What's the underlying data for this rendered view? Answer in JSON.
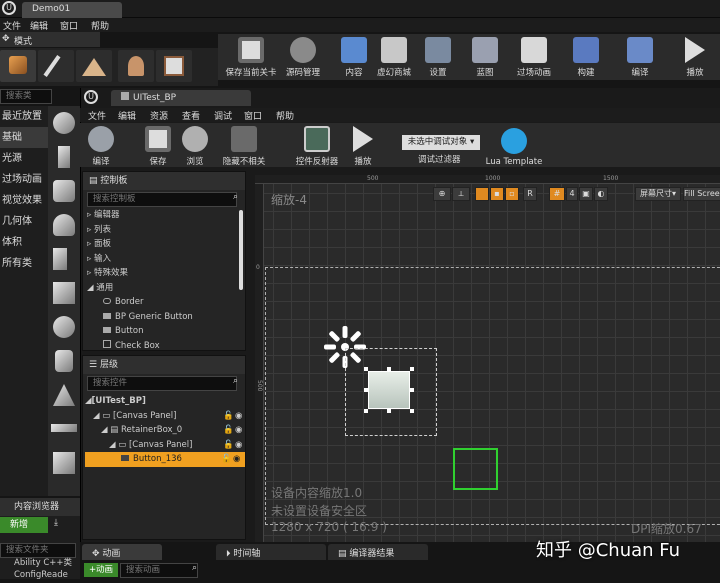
{
  "app": {
    "project_tab": "Demo01",
    "menu": [
      "文件",
      "编辑",
      "窗口",
      "帮助"
    ]
  },
  "modes": {
    "title": "模式",
    "search_placeholder": "搜索类",
    "categories": [
      "最近放置",
      "基础",
      "光源",
      "过场动画",
      "视觉效果",
      "几何体",
      "体积",
      "所有类"
    ],
    "selected_category": "基础"
  },
  "main_toolbar": [
    "保存当前关卡",
    "源码管理",
    "内容",
    "虚幻商城",
    "设置",
    "蓝图",
    "过场动画",
    "构建",
    "编译",
    "播放"
  ],
  "content_browser": {
    "title": "内容浏览器",
    "new_button": "新增",
    "search_placeholder": "搜索文件夹",
    "items": [
      "Ability C++类",
      "ConfigReade"
    ]
  },
  "umg": {
    "tab": "UITest_BP",
    "menu": [
      "文件",
      "编辑",
      "资源",
      "查看",
      "调试",
      "窗口",
      "帮助"
    ],
    "toolbar": [
      "编译",
      "保存",
      "浏览",
      "隐藏不相关",
      "控件反射器",
      "播放"
    ],
    "debug_filter": {
      "dropdown": "未选中调试对象",
      "label": "调试过滤器"
    },
    "lua_template": "Lua Template",
    "palette": {
      "title": "控制板",
      "search_placeholder": "搜索控制板",
      "categories": [
        "编辑器",
        "列表",
        "面板",
        "输入",
        "特殊效果",
        "通用"
      ],
      "common_items": [
        "Border",
        "BP Generic Button",
        "Button",
        "Check Box"
      ]
    },
    "hierarchy": {
      "title": "层级",
      "search_placeholder": "搜索控件",
      "tree": [
        "[UITest_BP]",
        "[Canvas Panel]",
        "RetainerBox_0",
        "[Canvas Panel]",
        "Button_136"
      ],
      "selected": "Button_136"
    },
    "designer": {
      "zoom": "缩放-4",
      "ruler_x": [
        "500",
        "1000",
        "1500"
      ],
      "ruler_y": [
        "0",
        "500"
      ],
      "toolbar_buttons": [
        "R",
        "4"
      ],
      "screen_size": "屏幕尺寸",
      "fill_screen": "Fill Screen",
      "device_zoom": "设备内容缩放1.0",
      "no_safe_zone": "未设置设备安全区",
      "resolution": "1280 x 720 ( 16:9 )",
      "dpi_scale": "DPI缩放0.67"
    },
    "bottom_tabs": [
      "动画",
      "时间轴",
      "编译器结果"
    ],
    "animations": {
      "add_button": "+动画",
      "search_placeholder": "搜索动画"
    }
  },
  "watermark": "知乎 @Chuan Fu"
}
